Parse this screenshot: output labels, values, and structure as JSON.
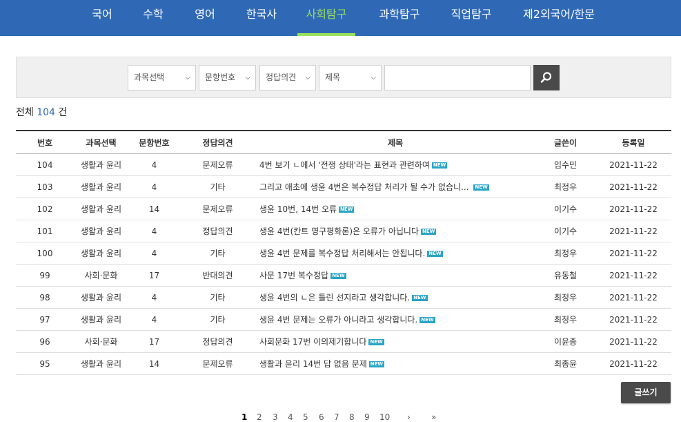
{
  "nav": {
    "tabs": [
      "국어",
      "수학",
      "영어",
      "한국사",
      "사회탐구",
      "과학탐구",
      "직업탐구",
      "제2외국어/한문"
    ],
    "active_index": 4,
    "background_color": "#2f69b6",
    "active_color": "#9be05a"
  },
  "search": {
    "subject_select": "과목선택",
    "question_select": "문항번호",
    "opinion_select": "정답의견",
    "field_select": "제목",
    "query": "",
    "search_icon": "search-icon"
  },
  "summary": {
    "prefix": "전체",
    "count": "104",
    "suffix": "건"
  },
  "table": {
    "headers": [
      "번호",
      "과목선택",
      "문항번호",
      "정답의견",
      "제목",
      "글쓴이",
      "등록일"
    ],
    "new_badge": "NEW",
    "rows": [
      [
        "104",
        "생활과 윤리",
        "4",
        "문제오류",
        "4번 보기 ㄴ에서 '전쟁 상태'라는 표현과 관련하여",
        "임수민",
        "2021-11-22"
      ],
      [
        "103",
        "생활과 윤리",
        "4",
        "기타",
        "그리고 애초에 생윤 4번은 복수정답 처리가 될 수가 없습니... ",
        "최정우",
        "2021-11-22"
      ],
      [
        "102",
        "생활과 윤리",
        "14",
        "문제오류",
        "생윤 10번, 14번 오류",
        "이기수",
        "2021-11-22"
      ],
      [
        "101",
        "생활과 윤리",
        "4",
        "정답의견",
        "생윤 4번(칸트 영구평화론)은 오류가 아닙니다",
        "이기수",
        "2021-11-22"
      ],
      [
        "100",
        "생활과 윤리",
        "4",
        "기타",
        "생윤 4번 문제를 복수정답 처리해서는 안됩니다.",
        "최정우",
        "2021-11-22"
      ],
      [
        "99",
        "사회·문화",
        "17",
        "반대의견",
        "사문 17번 복수정답",
        "유동철",
        "2021-11-22"
      ],
      [
        "98",
        "생활과 윤리",
        "4",
        "기타",
        "생윤 4번의 ㄴ은 틀린 선지라고 생각합니다.",
        "최정우",
        "2021-11-22"
      ],
      [
        "97",
        "생활과 윤리",
        "4",
        "기타",
        "생윤 4번 문제는 오류가 아니라고 생각합니다.",
        "최정우",
        "2021-11-22"
      ],
      [
        "96",
        "사회·문화",
        "17",
        "정답의견",
        "사회문화 17번 이의제기합니다",
        "이윤종",
        "2021-11-22"
      ],
      [
        "95",
        "생활과 윤리",
        "14",
        "문제오류",
        "생활과 윤리 14번 답 없음 문제",
        "최종윤",
        "2021-11-22"
      ]
    ]
  },
  "write_button": "글쓰기",
  "pagination": {
    "pages": [
      "1",
      "2",
      "3",
      "4",
      "5",
      "6",
      "7",
      "8",
      "9",
      "10"
    ],
    "current": "1",
    "next": "›",
    "last": "»"
  }
}
